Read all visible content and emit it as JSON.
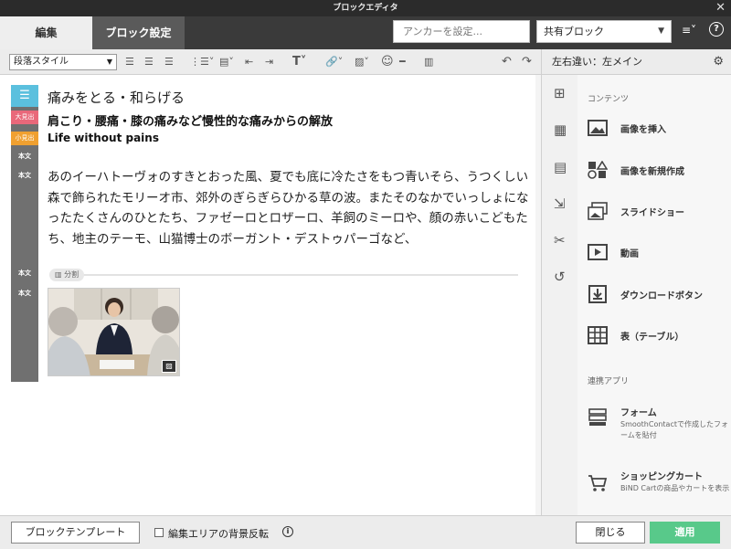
{
  "window": {
    "title": "ブロックエディタ",
    "close_glyph": "✕"
  },
  "tabs": [
    {
      "label": "編集",
      "active": true
    },
    {
      "label": "ブロック設定",
      "active": false
    }
  ],
  "header": {
    "anchor_placeholder": "アンカーを設定...",
    "shared_block": "共有ブロック",
    "menu_glyph": "≡˅",
    "help_glyph": "?"
  },
  "toolbar": {
    "paragraph_style": "段落スタイル",
    "buttons": [
      "align-left",
      "align-center",
      "align-right",
      "list",
      "block",
      "indent-decrease",
      "indent-increase",
      "font",
      "link",
      "image",
      "emoji",
      "horizontal-rule",
      "columns",
      "undo",
      "redo"
    ]
  },
  "editor": {
    "badges": {
      "big_heading": "大見出",
      "small_heading": "小見出",
      "body": "本文"
    },
    "paragraph_text": "痛みをとる・和らげる",
    "big_heading_text": "肩こり・腰痛・膝の痛みなど慢性的な痛みからの解放",
    "small_heading_text": "Life without pains",
    "body_text": "あのイーハトーヴォのすきとおった風、夏でも底に冷たさをもつ青いそら、うつくしい森で飾られたモリーオ市、郊外のぎらぎらひかる草の波。またそのなかでいっしょになったたくさんのひとたち、ファゼーロとロザーロ、羊飼のミーロや、顔の赤いこどもたち、地主のテーモ、山猫博士のボーガント・デストゥパーゴなど、",
    "divider_label": "分割"
  },
  "right_panel": {
    "layout_label": "左右違い：左メイン",
    "sections": {
      "contents": "コンテンツ",
      "apps": "連携アプリ"
    },
    "items": [
      {
        "label": "画像を挿入",
        "icon": "image-icon"
      },
      {
        "label": "画像を新規作成",
        "icon": "shapes-icon"
      },
      {
        "label": "スライドショー",
        "icon": "slideshow-icon"
      },
      {
        "label": "動画",
        "icon": "video-icon"
      },
      {
        "label": "ダウンロードボタン",
        "icon": "download-icon"
      },
      {
        "label": "表（テーブル）",
        "icon": "table-icon"
      }
    ],
    "apps": [
      {
        "label": "フォーム",
        "desc": "SmoothContactで作成したフォームを貼付"
      },
      {
        "label": "ショッピングカート",
        "desc": "BiND Cartの商品やカートを表示"
      }
    ]
  },
  "footer": {
    "template_button": "ブロックテンプレート",
    "bg_invert_label": "編集エリアの背景反転",
    "info_glyph": "i",
    "close_button": "閉じる",
    "apply_button": "適用"
  },
  "colors": {
    "accent_apply": "#58c98a",
    "badge_paragraph": "#5bc0de",
    "badge_big": "#e9687a",
    "badge_small": "#f0a030"
  }
}
